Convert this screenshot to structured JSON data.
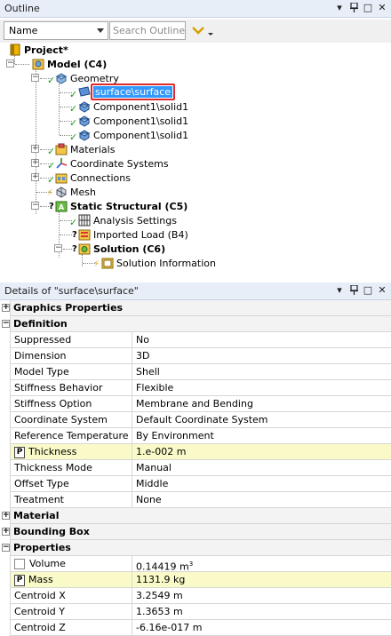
{
  "outline": {
    "title": "Outline",
    "filter_value": "Name",
    "search_placeholder": "Search Outline"
  },
  "tree": {
    "project": "Project*",
    "model": "Model (C4)",
    "geometry": "Geometry",
    "surface": "surface\\surface",
    "component1": "Component1\\solid1",
    "component2": "Component1\\solid1",
    "component3": "Component1\\solid1",
    "materials": "Materials",
    "coordinate_systems": "Coordinate Systems",
    "connections": "Connections",
    "mesh": "Mesh",
    "static_structural": "Static Structural (C5)",
    "analysis_settings": "Analysis Settings",
    "imported_load": "Imported Load (B4)",
    "solution": "Solution (C6)",
    "solution_information": "Solution Information"
  },
  "details": {
    "title": "Details of \"surface\\surface\"",
    "rows": [
      {
        "type": "cat",
        "toggle": "+",
        "name": "Graphics Properties"
      },
      {
        "type": "cat",
        "toggle": "−",
        "name": "Definition"
      },
      {
        "k": "Suppressed",
        "v": "No"
      },
      {
        "k": "Dimension",
        "v": "3D"
      },
      {
        "k": "Model Type",
        "v": "Shell"
      },
      {
        "k": "Stiffness Behavior",
        "v": "Flexible"
      },
      {
        "k": "Stiffness Option",
        "v": "Membrane and Bending"
      },
      {
        "k": "Coordinate System",
        "v": "Default Coordinate System"
      },
      {
        "k": "Reference Temperature",
        "v": "By Environment"
      },
      {
        "k": "Thickness",
        "v": "1.e-002 m",
        "param": "P",
        "hl": true
      },
      {
        "k": "Thickness Mode",
        "v": "Manual"
      },
      {
        "k": "Offset Type",
        "v": "Middle"
      },
      {
        "k": "Treatment",
        "v": "None"
      },
      {
        "type": "cat",
        "toggle": "+",
        "name": "Material"
      },
      {
        "type": "cat",
        "toggle": "+",
        "name": "Bounding Box"
      },
      {
        "type": "cat",
        "toggle": "−",
        "name": "Properties"
      },
      {
        "k": "Volume",
        "v": "0.14419 m",
        "sup": "3",
        "checkbox": true
      },
      {
        "k": "Mass",
        "v": "1131.9 kg",
        "param": "P",
        "hl": true
      },
      {
        "k": "Centroid X",
        "v": "3.2549 m"
      },
      {
        "k": "Centroid Y",
        "v": "1.3653 m"
      },
      {
        "k": "Centroid Z",
        "v": "-6.16e-017 m"
      }
    ]
  },
  "window_controls": [
    "▾",
    "pin",
    "□",
    "✕"
  ]
}
